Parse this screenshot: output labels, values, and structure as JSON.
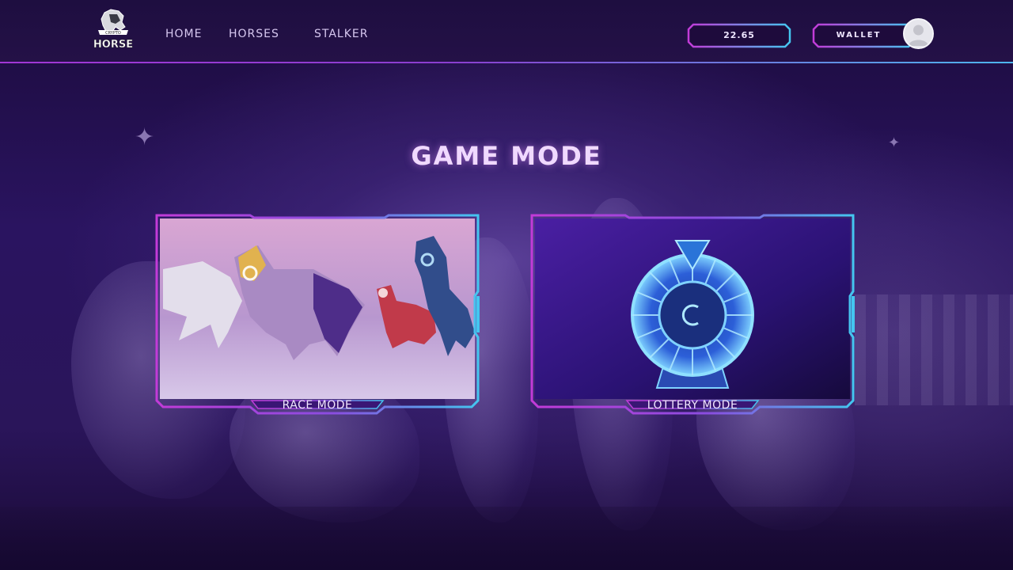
{
  "header": {
    "logo_text_top": "CRYPTO",
    "logo_text_main": "HORSE",
    "nav": [
      {
        "label": "HOME"
      },
      {
        "label": "HORSES"
      },
      {
        "label": "STALKER"
      }
    ],
    "balance": "22.65",
    "wallet_label": "WALLET"
  },
  "main": {
    "title": "GAME MODE",
    "cards": [
      {
        "label": "RACE MODE",
        "image": "horses-racing-image"
      },
      {
        "label": "LOTTERY MODE",
        "image": "lottery-wheel-image"
      }
    ]
  },
  "colors": {
    "accent_pink": "#c23bd8",
    "accent_cyan": "#44c6f0",
    "background": "#2a1460"
  }
}
